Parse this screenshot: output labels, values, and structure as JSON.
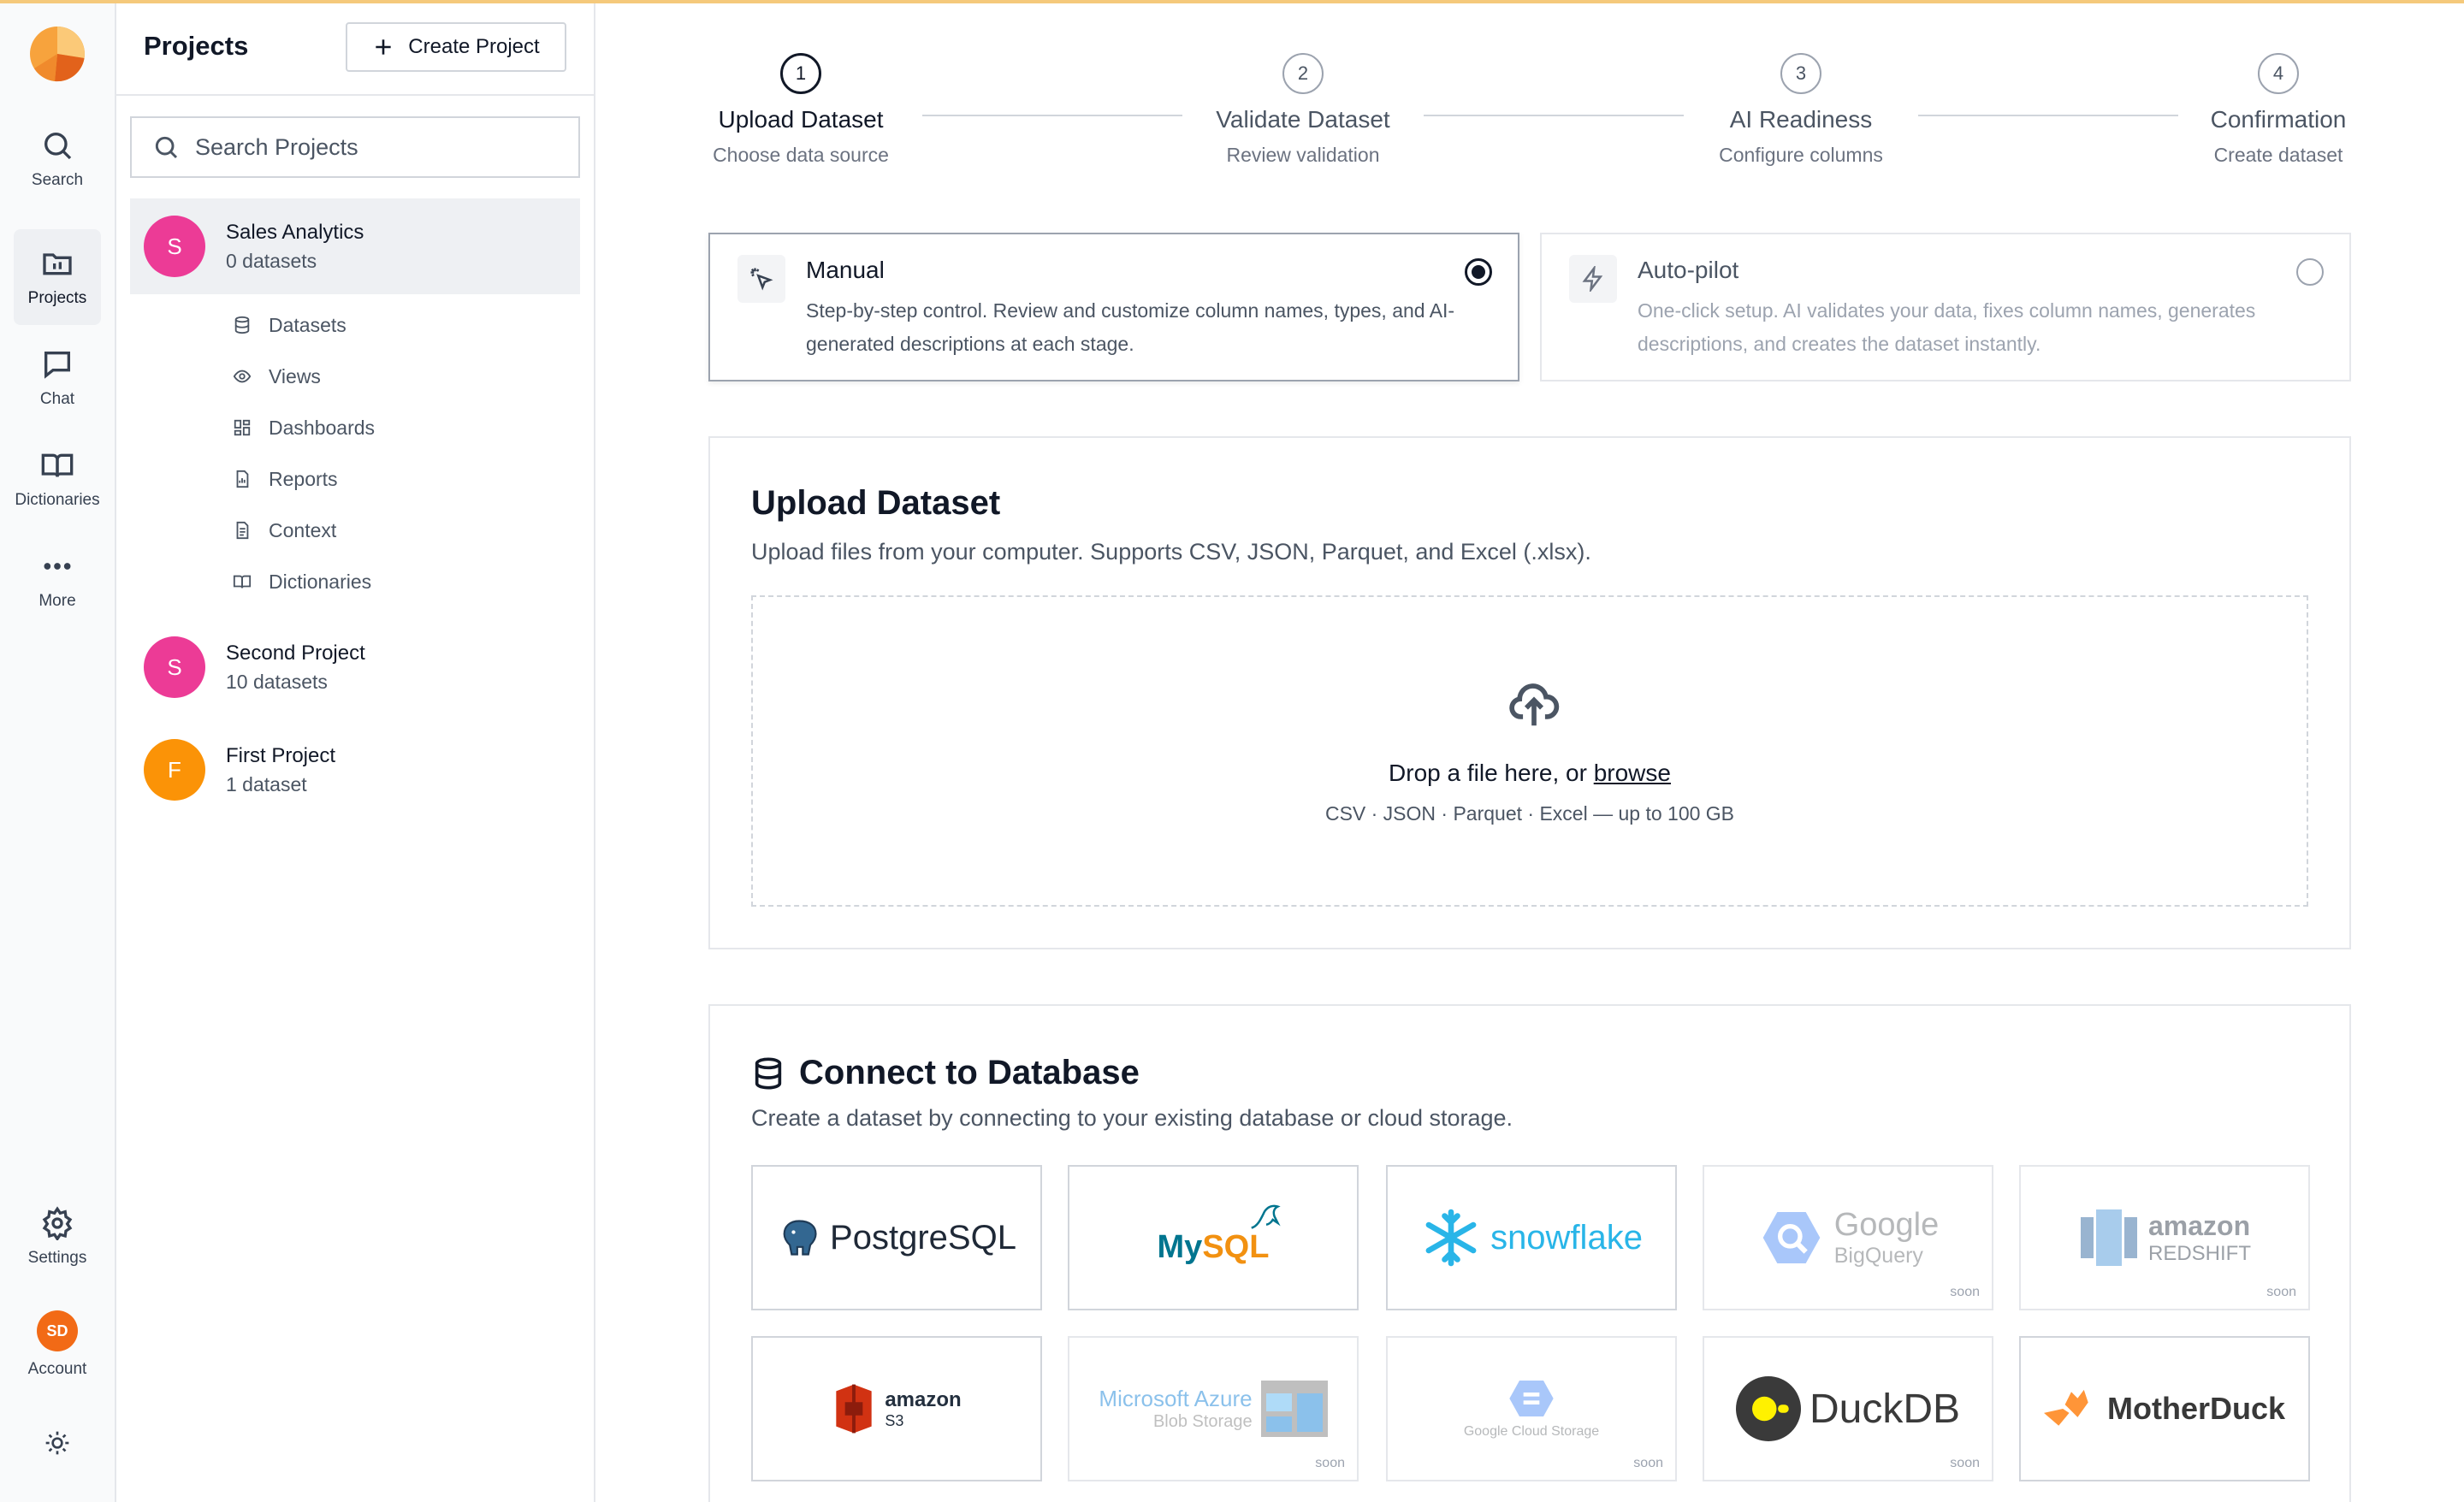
{
  "rail": {
    "items": [
      {
        "label": "Search",
        "icon": "search-icon"
      },
      {
        "label": "Projects",
        "icon": "folder-icon"
      },
      {
        "label": "Chat",
        "icon": "chat-icon"
      },
      {
        "label": "Dictionaries",
        "icon": "book-icon"
      },
      {
        "label": "More",
        "icon": "more-icon"
      }
    ],
    "settings_label": "Settings",
    "account_label": "Account",
    "account_initials": "SD",
    "theme_icon": "sun-icon"
  },
  "projects_panel": {
    "title": "Projects",
    "create_label": "Create Project",
    "search_placeholder": "Search Projects",
    "projects": [
      {
        "initial": "S",
        "name": "Sales Analytics",
        "count": "0 datasets",
        "color": "#ec3b96"
      },
      {
        "initial": "S",
        "name": "Second Project",
        "count": "10 datasets",
        "color": "#ec3b96"
      },
      {
        "initial": "F",
        "name": "First Project",
        "count": "1 dataset",
        "color": "#fb9307"
      }
    ],
    "subnav": [
      "Datasets",
      "Views",
      "Dashboards",
      "Reports",
      "Context",
      "Dictionaries"
    ]
  },
  "stepper": {
    "steps": [
      {
        "num": "1",
        "title": "Upload Dataset",
        "sub": "Choose data source"
      },
      {
        "num": "2",
        "title": "Validate Dataset",
        "sub": "Review validation"
      },
      {
        "num": "3",
        "title": "AI Readiness",
        "sub": "Configure columns"
      },
      {
        "num": "4",
        "title": "Confirmation",
        "sub": "Create dataset"
      }
    ]
  },
  "modes": {
    "manual": {
      "title": "Manual",
      "desc": "Step-by-step control. Review and customize column names, types, and AI-generated descriptions at each stage."
    },
    "autopilot": {
      "title": "Auto-pilot",
      "desc": "One-click setup. AI validates your data, fixes column names, generates descriptions, and creates the dataset instantly."
    }
  },
  "upload": {
    "title": "Upload Dataset",
    "desc": "Upload files from your computer. Supports CSV, JSON, Parquet, and Excel (.xlsx).",
    "drop_text": "Drop a file here, or ",
    "browse": "browse",
    "hint": "CSV · JSON · Parquet · Excel — up to 100 GB"
  },
  "database": {
    "title": "Connect to Database",
    "desc": "Create a dataset by connecting to your existing database or cloud storage.",
    "soon_label": "soon",
    "tiles": [
      {
        "name": "PostgreSQL",
        "soon": false
      },
      {
        "name_a": "My",
        "name_b": "SQL",
        "soon": false
      },
      {
        "name": "snowflake",
        "soon": false
      },
      {
        "name": "Google",
        "sub": "BigQuery",
        "soon": true
      },
      {
        "name": "amazon",
        "sub": "REDSHIFT",
        "soon": true
      },
      {
        "name": "amazon",
        "sub": "S3",
        "soon": false
      },
      {
        "name": "Microsoft Azure",
        "sub": "Blob Storage",
        "soon": true
      },
      {
        "name": "Google Cloud Storage",
        "soon": true
      },
      {
        "name": "DuckDB",
        "soon": false
      },
      {
        "name": "MotherDuck",
        "soon": false
      }
    ]
  },
  "colors": {
    "accent": "#111827",
    "topline": "#f5c97b",
    "postgres": "#336791",
    "mysql": "#00758f",
    "snowflake": "#29b5e8",
    "amazon_red": "#d13212"
  }
}
